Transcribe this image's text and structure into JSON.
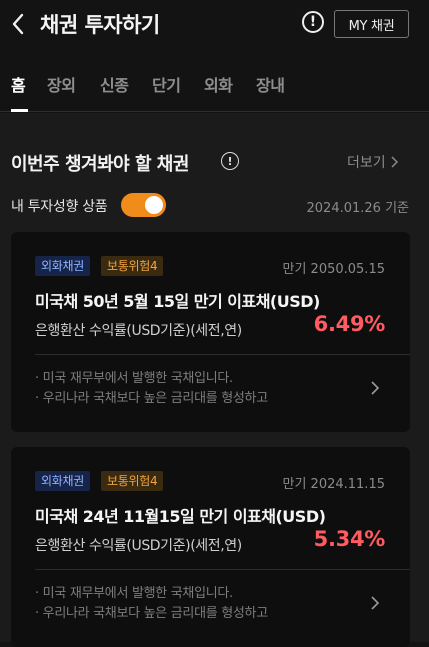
{
  "header": {
    "title": "채권 투자하기",
    "info_symbol": "!",
    "my_bonds_label": "MY 채권"
  },
  "tabs": [
    {
      "label": "홈",
      "active": true
    },
    {
      "label": "장외",
      "active": false
    },
    {
      "label": "신종",
      "active": false
    },
    {
      "label": "단기",
      "active": false
    },
    {
      "label": "외화",
      "active": false
    },
    {
      "label": "장내",
      "active": false
    }
  ],
  "section": {
    "title": "이번주 챙겨봐야 할 채권",
    "info_symbol": "!",
    "more_label": "더보기",
    "preference_label": "내 투자성향 상품",
    "preference_on": true,
    "date_label": "2024.01.26 기준"
  },
  "cards": [
    {
      "badge_fx": "외화채권",
      "badge_risk": "보통위험4",
      "maturity": "만기 2050.05.15",
      "name": "미국채 50년 5월 15일 만기 이표채(USD)",
      "yield_label": "은행환산 수익률(USD기준)(세전,연)",
      "yield": "6.49%",
      "desc_line1": "· 미국 재무부에서 발행한 국채입니다.",
      "desc_line2": "· 우리나라 국채보다 높은 금리대를 형성하고"
    },
    {
      "badge_fx": "외화채권",
      "badge_risk": "보통위험4",
      "maturity": "만기 2024.11.15",
      "name": "미국채 24년 11월15일 만기 이표채(USD)",
      "yield_label": "은행환산 수익률(USD기준)(세전,연)",
      "yield": "5.34%",
      "desc_line1": "· 미국 재무부에서 발행한 국채입니다.",
      "desc_line2": "· 우리나라 국채보다 높은 금리대를 형성하고"
    }
  ],
  "colors": {
    "background": "#131313",
    "accent_orange": "#f08c1a",
    "yield_red": "#ff5b61",
    "badge_fx_text": "#8fb2ff",
    "badge_risk_text": "#f0a442"
  },
  "icons": {
    "back": "chevron-left-icon",
    "info": "exclamation-circle-icon",
    "more": "chevron-right-icon"
  }
}
